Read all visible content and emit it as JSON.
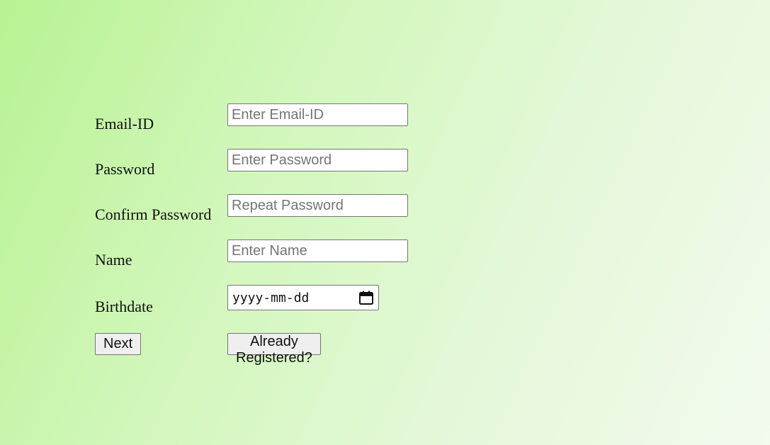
{
  "form": {
    "email": {
      "label": "Email-ID",
      "placeholder": "Enter Email-ID",
      "value": ""
    },
    "password": {
      "label": "Password",
      "placeholder": "Enter Password",
      "value": ""
    },
    "confirm_password": {
      "label": "Confirm Password",
      "placeholder": "Repeat Password",
      "value": ""
    },
    "name": {
      "label": "Name",
      "placeholder": "Enter Name",
      "value": ""
    },
    "birthdate": {
      "label": "Birthdate",
      "display": "yyyy-mm-dd",
      "icon": "calendar-icon"
    }
  },
  "buttons": {
    "next_label": "Next",
    "already_registered_label": "Already Registered?"
  },
  "colors": {
    "background_start": "#b8f293",
    "background_end": "#f3faee",
    "field_border": "#767676",
    "button_bg": "#efefef"
  }
}
